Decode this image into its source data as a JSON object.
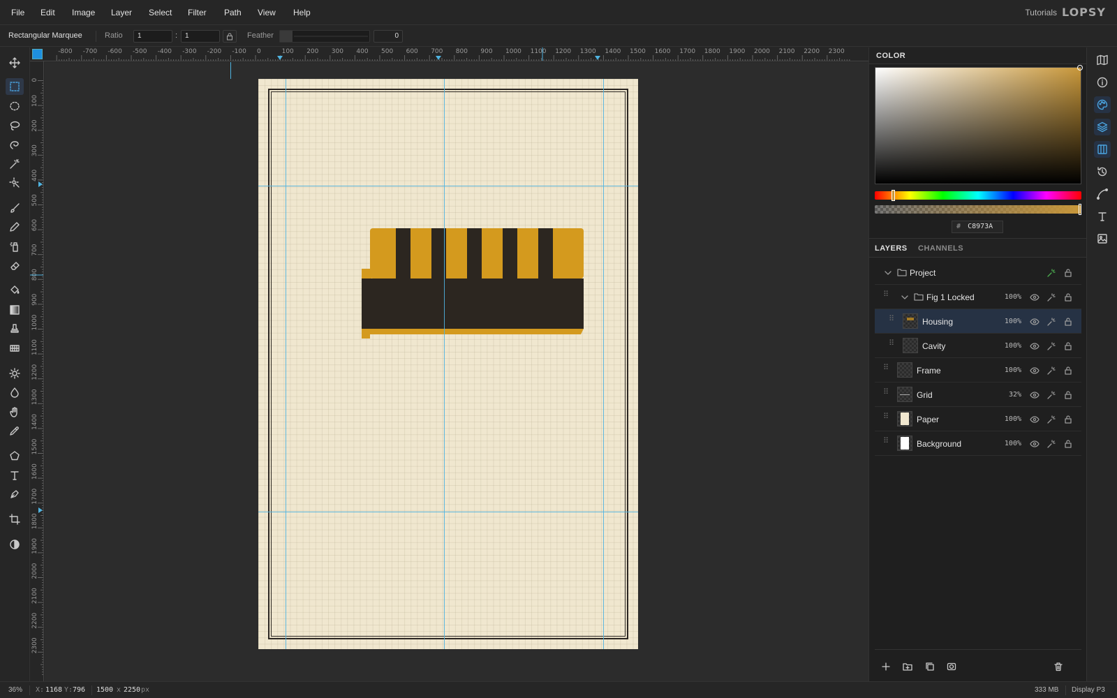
{
  "menu": {
    "items": [
      "File",
      "Edit",
      "Image",
      "Layer",
      "Select",
      "Filter",
      "Path",
      "View",
      "Help"
    ],
    "tutorials": "Tutorials",
    "logo": "LOPSY"
  },
  "options": {
    "tool_name": "Rectangular Marquee",
    "ratio_label": "Ratio",
    "ratio_a": "1",
    "ratio_sep": ":",
    "ratio_b": "1",
    "feather_label": "Feather",
    "feather_value": "0"
  },
  "tools": [
    {
      "name": "move-tool",
      "icon": "move-icon"
    },
    {
      "name": "rect-marquee-tool",
      "icon": "rect-select-icon",
      "active": true
    },
    {
      "name": "ellipse-marquee-tool",
      "icon": "ellipse-select-icon"
    },
    {
      "name": "lasso-tool",
      "icon": "lasso-icon"
    },
    {
      "name": "magnetic-lasso-tool",
      "icon": "magnetic-lasso-icon"
    },
    {
      "name": "magic-wand-tool",
      "icon": "magic-wand-icon"
    },
    {
      "name": "quick-select-tool",
      "icon": "quick-select-icon"
    },
    {
      "name": "brush-tool",
      "icon": "brush-icon"
    },
    {
      "name": "pencil-tool",
      "icon": "pencil-icon"
    },
    {
      "name": "spray-tool",
      "icon": "spray-icon"
    },
    {
      "name": "eraser-tool",
      "icon": "eraser-icon"
    },
    {
      "name": "fill-tool",
      "icon": "bucket-icon"
    },
    {
      "name": "gradient-tool",
      "icon": "gradient-icon"
    },
    {
      "name": "stamp-tool",
      "icon": "stamp-icon"
    },
    {
      "name": "pattern-tool",
      "icon": "pattern-icon"
    },
    {
      "name": "dodge-tool",
      "icon": "sun-icon"
    },
    {
      "name": "blur-tool",
      "icon": "drop-icon"
    },
    {
      "name": "hand-tool",
      "icon": "hand-icon"
    },
    {
      "name": "eyedropper-tool",
      "icon": "eyedropper-icon"
    },
    {
      "name": "shape-tool",
      "icon": "pentagon-icon"
    },
    {
      "name": "text-tool",
      "icon": "text-icon"
    },
    {
      "name": "pen-tool",
      "icon": "pen-icon"
    },
    {
      "name": "crop-tool",
      "icon": "crop-icon"
    },
    {
      "name": "color-swap-tool",
      "icon": "contrast-icon"
    }
  ],
  "rulers": {
    "top": [
      "-800",
      "-700",
      "-600",
      "-500",
      "-400",
      "-300",
      "-200",
      "-100",
      "0",
      "100",
      "200",
      "300",
      "400",
      "500",
      "600",
      "700",
      "800",
      "900",
      "1000",
      "1100",
      "1200",
      "1300",
      "1400",
      "1500",
      "1600",
      "1700",
      "1800",
      "1900",
      "2000",
      "2100",
      "2200",
      "2300"
    ],
    "left": [
      "0",
      "100",
      "200",
      "300",
      "400",
      "500",
      "600",
      "700",
      "800",
      "900",
      "1000",
      "1100",
      "1200",
      "1300",
      "1400",
      "1500",
      "1600",
      "1700",
      "1800",
      "1900",
      "2000",
      "2100",
      "2200",
      "2300"
    ]
  },
  "color_panel": {
    "tab": "COLOR",
    "hex_prefix": "#",
    "hex": "C8973A",
    "current_color": "#c8973a"
  },
  "layers_panel": {
    "tabs": [
      "LAYERS",
      "CHANNELS"
    ],
    "layers": [
      {
        "name": "Project",
        "opacity": "",
        "kind": "group",
        "depth": 0
      },
      {
        "name": "Fig 1 Locked",
        "opacity": "100%",
        "kind": "group",
        "depth": 1
      },
      {
        "name": "Housing",
        "opacity": "100%",
        "kind": "layer",
        "depth": 2,
        "selected": true
      },
      {
        "name": "Cavity",
        "opacity": "100%",
        "kind": "layer",
        "depth": 2
      },
      {
        "name": "Frame",
        "opacity": "100%",
        "kind": "layer",
        "depth": 1
      },
      {
        "name": "Grid",
        "opacity": "32%",
        "kind": "layer",
        "depth": 1
      },
      {
        "name": "Paper",
        "opacity": "100%",
        "kind": "layer",
        "depth": 1
      },
      {
        "name": "Background",
        "opacity": "100%",
        "kind": "layer",
        "depth": 1
      }
    ]
  },
  "colors": {
    "housing_gold": "#d49a1e",
    "housing_dark": "#2c2620",
    "paper": "#f0e7cf",
    "guide": "#4fb3e0",
    "accent": "#4aa3df"
  },
  "status": {
    "zoom": "36%",
    "cursor_x_label": "X:",
    "cursor_x": "1168",
    "cursor_y_label": "Y:",
    "cursor_y": "796",
    "doc_w": "1500",
    "doc_x": "x",
    "doc_h": "2250",
    "doc_unit": "px",
    "memory": "333 MB",
    "color_profile": "Display P3"
  }
}
